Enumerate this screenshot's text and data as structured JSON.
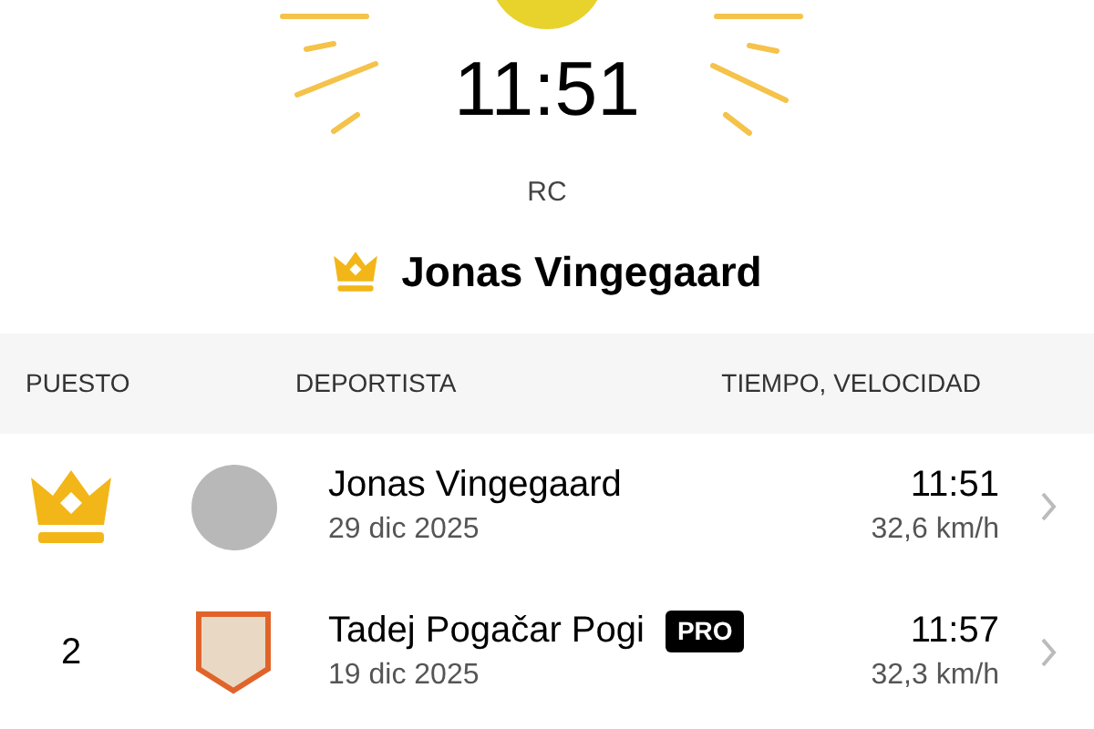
{
  "hero": {
    "time": "11:51",
    "subtitle": "RC",
    "leader_name": "Jonas Vingegaard"
  },
  "table": {
    "columns": [
      "PUESTO",
      "DEPORTISTA",
      "TIEMPO, VELOCIDAD"
    ],
    "rows": [
      {
        "kind": "crown",
        "avatar": {
          "kind": "round"
        },
        "name": "Jonas Vingegaard",
        "date": "29 dic 2025",
        "time": "11:51",
        "speed": "32,6 km/h"
      },
      {
        "kind": "number",
        "rank": "2",
        "avatar": {
          "kind": "shield"
        },
        "name": "Tadej Pogačar Pogi",
        "badge": "PRO",
        "date": "19 dic 2025",
        "time": "11:57",
        "speed": "32,3 km/h"
      }
    ]
  }
}
